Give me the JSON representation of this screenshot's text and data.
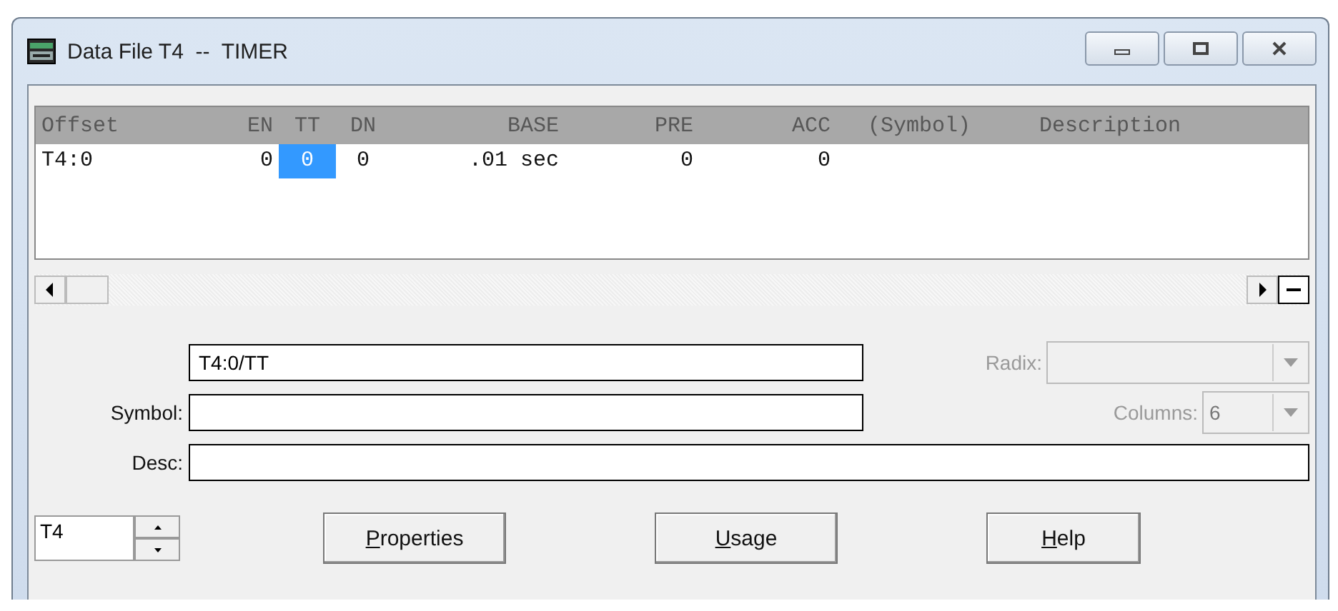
{
  "window": {
    "title": "Data File T4  --  TIMER"
  },
  "table": {
    "columns": [
      "Offset",
      "EN",
      "TT",
      "DN",
      "BASE",
      "PRE",
      "ACC",
      "(Symbol)",
      "Description"
    ],
    "rows": [
      {
        "cells": [
          {
            "text": "T4:0",
            "selected": false
          },
          {
            "text": "0",
            "selected": false
          },
          {
            "text": "0",
            "selected": true
          },
          {
            "text": "0",
            "selected": false
          },
          {
            "text": ".01 sec",
            "selected": false
          },
          {
            "text": "0",
            "selected": false
          },
          {
            "text": "0",
            "selected": false
          }
        ]
      }
    ]
  },
  "address_field": {
    "value": "T4:0/TT"
  },
  "symbol_field": {
    "label": "Symbol:"
  },
  "desc_field": {
    "label": "Desc:"
  },
  "radix": {
    "label": "Radix:",
    "disabled": true
  },
  "columns_select": {
    "label": "Columns:",
    "value": "6",
    "disabled": true
  },
  "file_spinner": {
    "value": "T4"
  },
  "buttons": [
    "Properties",
    "Usage",
    "Help"
  ]
}
